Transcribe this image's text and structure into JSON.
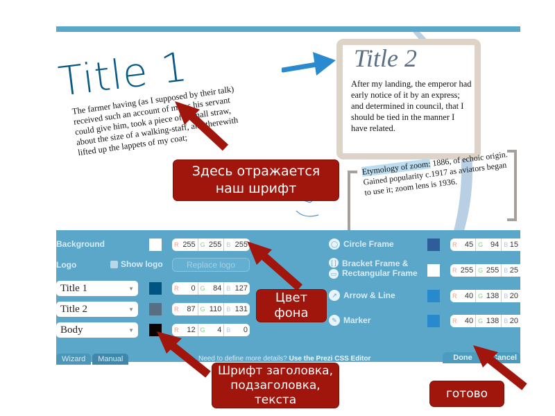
{
  "preview": {
    "title1": "Title 1",
    "body1": "The farmer having (as I supposed by their talk) received such an account of me as his servant could give him, took a piece of a small straw, about the size of a walking-staff, and therewith lifted up the lappets of my coat;",
    "title2": "Title 2",
    "body2": "After my landing, the emperor had early notice of it by an express; and determined in council, that I should be tied in the manner I have related.",
    "etymology_heading": "Etymology of zoom:",
    "etymology_body": "1886, of echoic origin. Gained popularity c.1917 as aviators began to use it; zoom lens is 1936."
  },
  "panel": {
    "background": {
      "label": "Background",
      "color": "#ffffff",
      "r": "255",
      "g": "255",
      "b": "255"
    },
    "logo": {
      "label": "Logo",
      "show_logo_label": "Show logo",
      "show_logo_checked": false,
      "replace_label": "Replace logo"
    },
    "fonts": [
      {
        "name": "Title 1",
        "color": "#00547f",
        "r": "0",
        "g": "84",
        "b": "127"
      },
      {
        "name": "Title 2",
        "color": "#576e83",
        "r": "87",
        "g": "110",
        "b": "131"
      },
      {
        "name": "Body",
        "color": "#0c0400",
        "r": "12",
        "g": "4",
        "b": "0"
      }
    ],
    "elements": [
      {
        "label": "Circle Frame",
        "icon": "circle-frame-icon",
        "color": "#2d5e9a",
        "r": "45",
        "g": "94",
        "b": "15"
      },
      {
        "label": "Bracket Frame &",
        "label2": "Rectangular Frame",
        "icon": "bracket-frame-icon",
        "color": "#ffffff",
        "r": "255",
        "g": "255",
        "b": "25"
      },
      {
        "label": "Arrow & Line",
        "icon": "arrow-line-icon",
        "color": "#288acd",
        "r": "40",
        "g": "138",
        "b": "20"
      },
      {
        "label": "Marker",
        "icon": "marker-icon",
        "color": "#288acd",
        "r": "40",
        "g": "138",
        "b": "20"
      }
    ],
    "rgb_keys": {
      "r": "R",
      "g": "G",
      "b": "B"
    },
    "tabs": [
      {
        "label": "Wizard",
        "active": false
      },
      {
        "label": "Manual",
        "active": true
      }
    ],
    "hint_text": "Need to define more details?",
    "hint_link": "Use the Prezi CSS Editor",
    "done_label": "Done",
    "cancel_label": "Cancel"
  },
  "callouts": {
    "font_here": [
      "Здесь отражается",
      "наш шрифт"
    ],
    "bg_color": [
      "Цвет",
      "фона"
    ],
    "font_types": [
      "Шрифт заголовка,",
      "подзаголовка,",
      "текста"
    ],
    "done": "готово"
  },
  "colors": {
    "panel": "#5aa7ca",
    "callout": "#a0160c",
    "accent_arrow": "#2a8ad0"
  }
}
